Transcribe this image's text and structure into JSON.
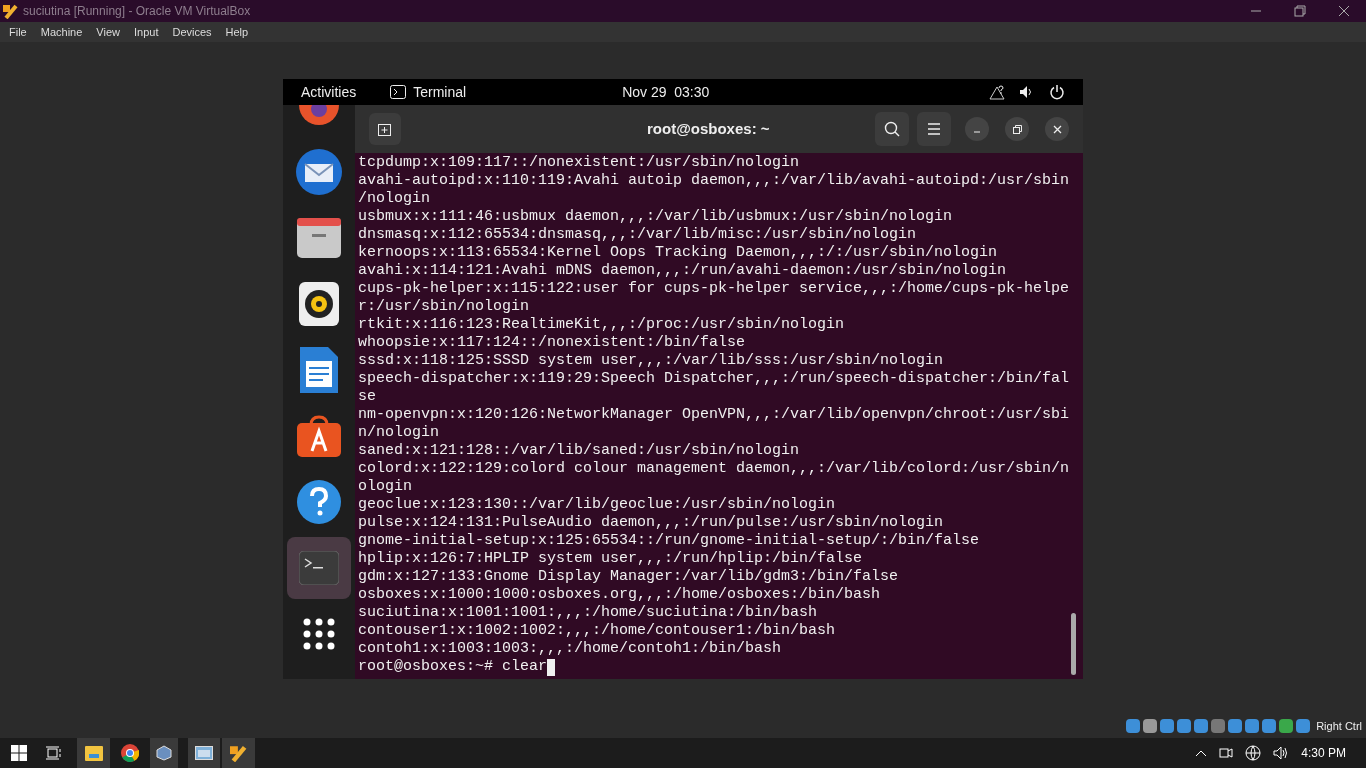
{
  "window": {
    "title": "suciutina [Running] - Oracle VM VirtualBox"
  },
  "menu": [
    "File",
    "Machine",
    "View",
    "Input",
    "Devices",
    "Help"
  ],
  "gnome_bar": {
    "activities": "Activities",
    "app": "Terminal",
    "clock": "Nov 29  03:30"
  },
  "terminal": {
    "title": "root@osboxes: ~",
    "lines": [
      "tcpdump:x:109:117::/nonexistent:/usr/sbin/nologin",
      "avahi-autoipd:x:110:119:Avahi autoip daemon,,,:/var/lib/avahi-autoipd:/usr/sbin",
      "/nologin",
      "usbmux:x:111:46:usbmux daemon,,,:/var/lib/usbmux:/usr/sbin/nologin",
      "dnsmasq:x:112:65534:dnsmasq,,,:/var/lib/misc:/usr/sbin/nologin",
      "kernoops:x:113:65534:Kernel Oops Tracking Daemon,,,:/:/usr/sbin/nologin",
      "avahi:x:114:121:Avahi mDNS daemon,,,:/run/avahi-daemon:/usr/sbin/nologin",
      "cups-pk-helper:x:115:122:user for cups-pk-helper service,,,:/home/cups-pk-helpe",
      "r:/usr/sbin/nologin",
      "rtkit:x:116:123:RealtimeKit,,,:/proc:/usr/sbin/nologin",
      "whoopsie:x:117:124::/nonexistent:/bin/false",
      "sssd:x:118:125:SSSD system user,,,:/var/lib/sss:/usr/sbin/nologin",
      "speech-dispatcher:x:119:29:Speech Dispatcher,,,:/run/speech-dispatcher:/bin/fal",
      "se",
      "nm-openvpn:x:120:126:NetworkManager OpenVPN,,,:/var/lib/openvpn/chroot:/usr/sbi",
      "n/nologin",
      "saned:x:121:128::/var/lib/saned:/usr/sbin/nologin",
      "colord:x:122:129:colord colour management daemon,,,:/var/lib/colord:/usr/sbin/n",
      "ologin",
      "geoclue:x:123:130::/var/lib/geoclue:/usr/sbin/nologin",
      "pulse:x:124:131:PulseAudio daemon,,,:/run/pulse:/usr/sbin/nologin",
      "gnome-initial-setup:x:125:65534::/run/gnome-initial-setup/:/bin/false",
      "hplip:x:126:7:HPLIP system user,,,:/run/hplip:/bin/false",
      "gdm:x:127:133:Gnome Display Manager:/var/lib/gdm3:/bin/false",
      "osboxes:x:1000:1000:osboxes.org,,,:/home/osboxes:/bin/bash",
      "suciutina:x:1001:1001:,,,:/home/suciutina:/bin/bash",
      "contouser1:x:1002:1002:,,,:/home/contouser1:/bin/bash",
      "contoh1:x:1003:1003:,,,:/home/contoh1:/bin/bash"
    ],
    "prompt": "root@osboxes:~# ",
    "command": "clear"
  },
  "dock": [
    {
      "kind": "browser",
      "selected": false
    },
    {
      "kind": "mail",
      "selected": false
    },
    {
      "kind": "files",
      "selected": false
    },
    {
      "kind": "music",
      "selected": false
    },
    {
      "kind": "writer",
      "selected": false
    },
    {
      "kind": "store",
      "selected": false
    },
    {
      "kind": "help",
      "selected": false
    },
    {
      "kind": "terminal",
      "selected": true
    },
    {
      "kind": "grid",
      "selected": false
    }
  ],
  "vbox_status": {
    "host_key": "Right Ctrl"
  },
  "taskbar": {
    "clock": "4:30 PM"
  }
}
